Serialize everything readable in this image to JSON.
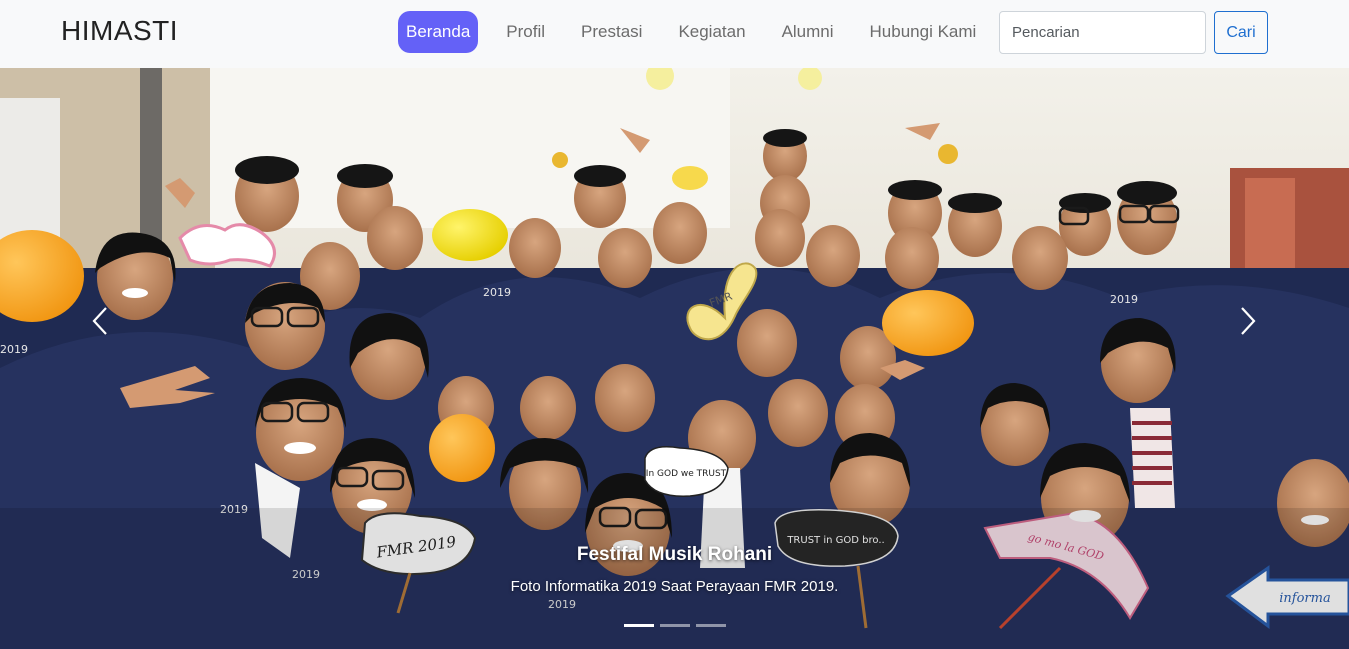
{
  "navbar": {
    "brand": "HIMASTI",
    "links": [
      {
        "label": "Beranda",
        "active": true
      },
      {
        "label": "Profil",
        "active": false
      },
      {
        "label": "Prestasi",
        "active": false
      },
      {
        "label": "Kegiatan",
        "active": false
      },
      {
        "label": "Alumni",
        "active": false
      },
      {
        "label": "Hubungi Kami",
        "active": false
      }
    ],
    "search": {
      "placeholder": "Pencarian",
      "value": ""
    },
    "search_button": "Cari",
    "colors": {
      "active_bg": "#6461f7",
      "button": "#1f6fd0"
    }
  },
  "carousel": {
    "caption_title": "Festifal Musik Rohani",
    "caption_text": "Foto Informatika 2019 Saat Perayaan FMR 2019.",
    "prev_icon": "chevron-left-icon",
    "next_icon": "chevron-right-icon",
    "indicators": [
      true,
      false,
      false
    ],
    "photo_text": {
      "jacket_year": "2019",
      "sign_left": "FMR 2019",
      "sign_heart": "FMR",
      "sign_god": "In GOD we TRUST",
      "sign_trust": "TRUST in GOD bro..",
      "sign_pink": "go mo la GOD",
      "sign_arrow": "informa"
    }
  }
}
